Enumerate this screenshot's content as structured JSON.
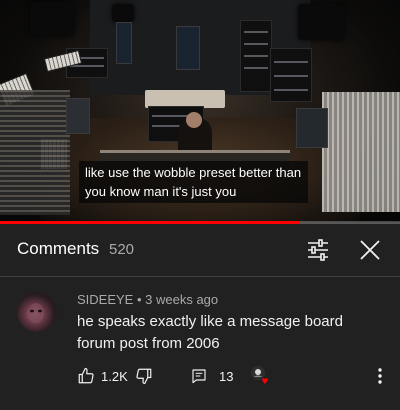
{
  "video": {
    "caption_lines": [
      "like use the wobble preset better than",
      "you know man it's just you"
    ],
    "progress_fraction": 0.75,
    "progress_color": "#ff0000"
  },
  "comments_panel": {
    "title": "Comments",
    "count": "520",
    "filter_icon": "sort-filter-icon",
    "close_icon": "close-icon"
  },
  "comment": {
    "author": "SIDEEYE",
    "separator": " • ",
    "time": "3 weeks ago",
    "text": "he speaks exactly like a message board forum post from 2006",
    "likes": "1.2K",
    "replies": "13",
    "icons": [
      "thumbs-up-icon",
      "thumbs-down-icon",
      "reply-icon",
      "creator-heart-icon",
      "more-vert-icon"
    ],
    "heart_color": "#ff0000"
  }
}
